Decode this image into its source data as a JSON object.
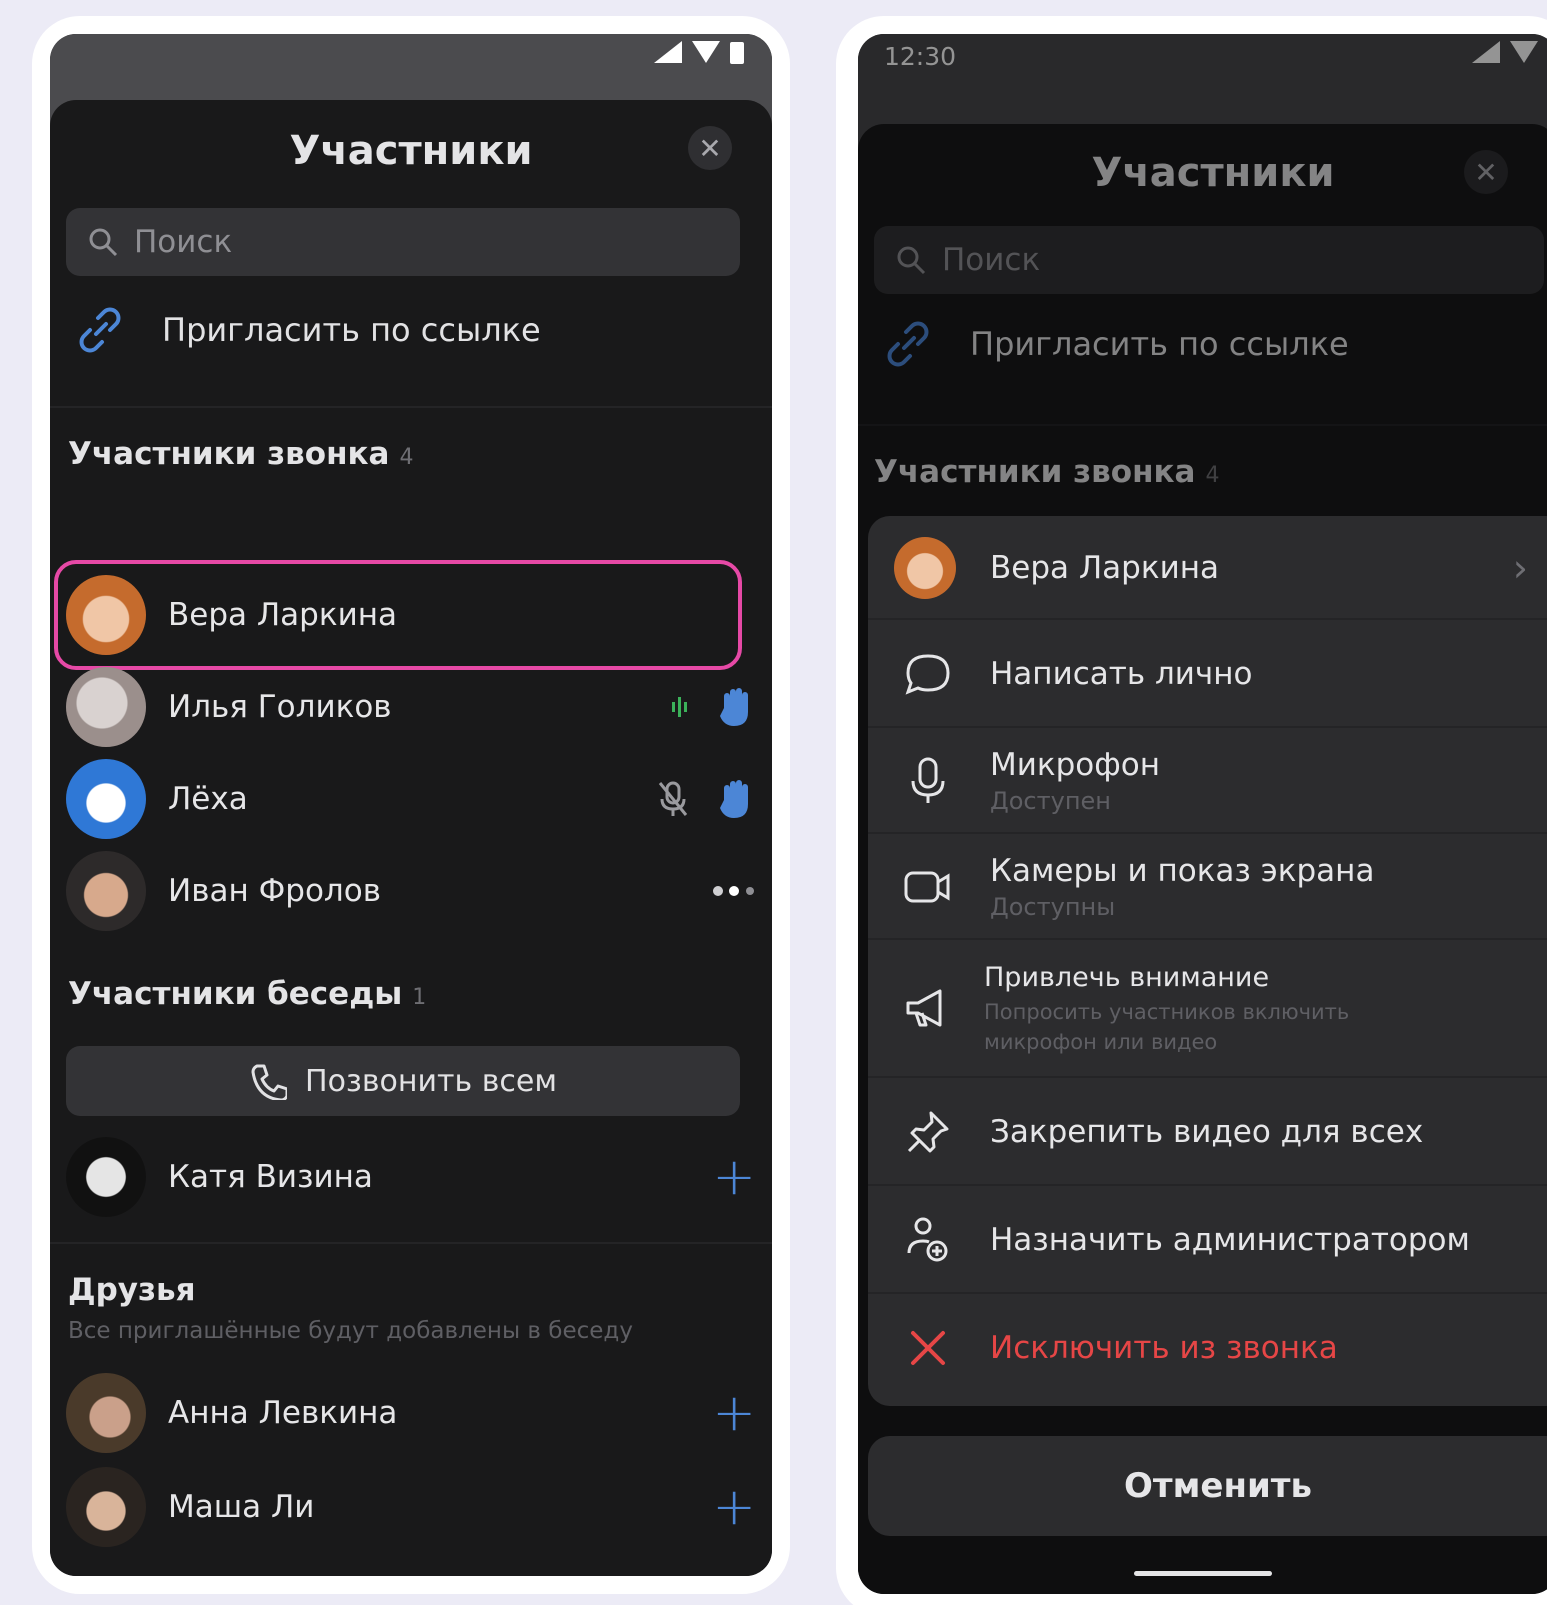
{
  "left": {
    "title": "Участники",
    "search_placeholder": "Поиск",
    "invite_label": "Пригласить по ссылке",
    "call_section": {
      "label": "Участники звонка",
      "count": "4"
    },
    "call_participants": [
      {
        "name": "Вера Ларкина"
      },
      {
        "name": "Илья Голиков"
      },
      {
        "name": "Лёха"
      },
      {
        "name": "Иван Фролов"
      }
    ],
    "chat_section": {
      "label": "Участники беседы",
      "count": "1"
    },
    "call_all_label": "Позвонить всем",
    "chat_members": [
      {
        "name": "Катя Визина"
      }
    ],
    "friends_section": {
      "label": "Друзья",
      "subtitle": "Все приглашённые будут добавлены в беседу"
    },
    "friends": [
      {
        "name": "Анна Левкина"
      },
      {
        "name": "Маша Ли"
      }
    ]
  },
  "right": {
    "status_time": "12:30",
    "title": "Участники",
    "search_placeholder": "Поиск",
    "invite_label": "Пригласить по ссылке",
    "call_section": {
      "label": "Участники звонка",
      "count": "4"
    },
    "menu": {
      "user_name": "Вера Ларкина",
      "items": [
        {
          "label": "Написать лично",
          "icon": "chat-bubble-icon"
        },
        {
          "label": "Микрофон",
          "sub": "Доступен",
          "icon": "microphone-icon"
        },
        {
          "label": "Камеры и показ экрана",
          "sub": "Доступны",
          "icon": "camera-icon"
        },
        {
          "label": "Привлечь внимание",
          "sub": "Попросить участников включить микрофон или видео",
          "icon": "megaphone-icon"
        },
        {
          "label": "Закрепить видео для всех",
          "icon": "pin-icon"
        },
        {
          "label": "Назначить администратором",
          "icon": "admin-add-icon"
        },
        {
          "label": "Исключить из звонка",
          "icon": "close-red-icon"
        }
      ]
    },
    "cancel_label": "Отменить"
  },
  "colors": {
    "accent_blue": "#4c86d6",
    "highlight_pink": "#e649a6",
    "danger_red": "#e64646",
    "speaking_green": "#3bb15a",
    "background": "#19191a"
  }
}
